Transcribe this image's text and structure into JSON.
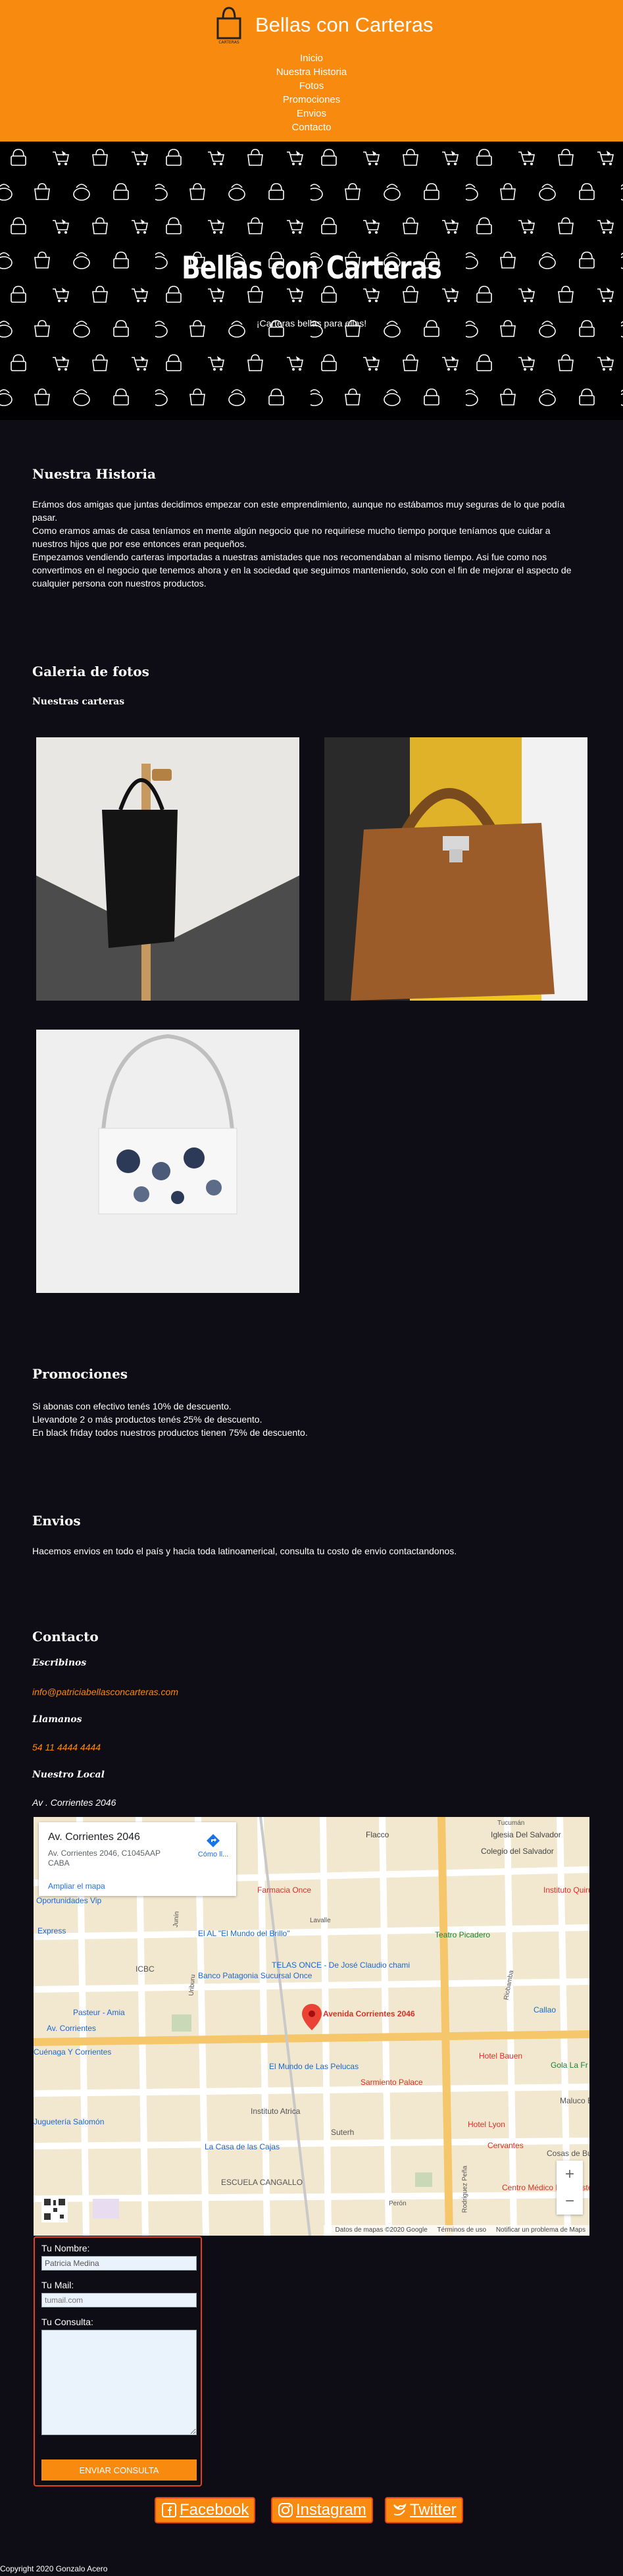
{
  "header": {
    "title": "Bellas con Carteras",
    "logo_text": "CARTERAS",
    "nav": [
      "Inicio",
      "Nuestra Historia",
      "Fotos",
      "Promociones",
      "Envios",
      "Contacto"
    ],
    "color": "#f98a10"
  },
  "hero": {
    "title": "Bellas con Carteras",
    "subtitle": "¡Carteras bellas para ellas!"
  },
  "historia": {
    "heading": "Nuestra Historia",
    "paragraphs": [
      "Erámos dos amigas que juntas decidimos empezar con este emprendimiento, aunque no estábamos muy seguras de lo que podía pasar.",
      "Como eramos amas de casa teníamos en mente algún negocio que no requiriese mucho tiempo porque teníamos que cuidar a nuestros hijos que por ese entonces eran pequeños.",
      "Empezamos vendiendo carteras importadas a nuestras amistades que nos recomendaban al mismo tiempo. Asi fue como nos convertimos en el negocio que tenemos ahora y en la sociedad que seguimos manteniendo, solo con el fin de mejorar el aspecto de cualquier persona con nuestros productos."
    ]
  },
  "galeria": {
    "heading": "Galeria de fotos",
    "subheading": "Nuestras carteras"
  },
  "promociones": {
    "heading": "Promociones",
    "lines": [
      "Si abonas con efectivo tenés 10% de descuento.",
      "Llevandote 2 o más productos tenés 25% de descuento.",
      "En black friday todos nuestros productos tienen 75% de descuento."
    ]
  },
  "envios": {
    "heading": "Envios",
    "text": "Hacemos envios en todo el país y hacia toda latinoamerical, consulta tu costo de envio contactandonos."
  },
  "contacto": {
    "heading": "Contacto",
    "write_label": "Escribinos",
    "email": "info@patriciabellasconcarteras.com",
    "call_label": "Llamanos",
    "phone": "54 11 4444 4444",
    "local_label": "Nuestro Local",
    "address": "Av . Corrientes 2046"
  },
  "map": {
    "card_title": "Av. Corrientes 2046",
    "card_address": "Av. Corrientes 2046, C1045AAP CABA",
    "enlarge": "Ampliar el mapa",
    "directions": "Cómo ll...",
    "pin_label": "Avenida Corrientes 2046",
    "labels": [
      "Colegio del Salvador",
      "Iglesia Del Salvador",
      "Flacco",
      "Tucumán",
      "Farmacia Once",
      "Lavalle",
      "Oportunidades Vip",
      "Express",
      "El AL \"El Mundo del Brillo\"",
      "Teatro Picadero",
      "Instituto Quirúrgico del Callao",
      "Banco Patagonia Sucursal Once",
      "ICBC",
      "TELAS ONCE - De José Claudio chami",
      "Pasteur - Amia",
      "Callao",
      "Av. Corrientes",
      "Hotel Bauen",
      "Gola La Fr",
      "Cuénaga Y Corrientes",
      "El Mundo de Las Pelucas",
      "Sarmiento Palace",
      "Instituto Atrica",
      "Maluco B",
      "Juguetería Salomón",
      "Suterh",
      "Hotel Lyon",
      "La Casa de las Cajas",
      "Cervantes",
      "Cosas de Bue",
      "ESCUELA CANGALLO",
      "Centro Médico Luis Pasteur",
      "Perón",
      "Rodriguez Peña",
      "Riobamba",
      "Junín",
      "Uriburu"
    ],
    "zoom_in": "+",
    "zoom_out": "−",
    "footer": [
      "Datos de mapas ©2020 Google",
      "Términos de uso",
      "Notificar un problema de Maps"
    ]
  },
  "form": {
    "name_label": "Tu Nombre:",
    "name_value": "Patricia Medina",
    "mail_label": "Tu Mail:",
    "mail_placeholder": "tumail.com",
    "consulta_label": "Tu Consulta:",
    "submit": "ENVIAR CONSULTA"
  },
  "social": [
    "Facebook",
    "Instagram",
    "Twitter"
  ],
  "footer": {
    "copyright": "Copyright 2020 Gonzalo Acero"
  },
  "colors": {
    "accent": "#f98a10",
    "background": "#0e0d15",
    "border": "#e0421b",
    "link": "#f98a10"
  }
}
